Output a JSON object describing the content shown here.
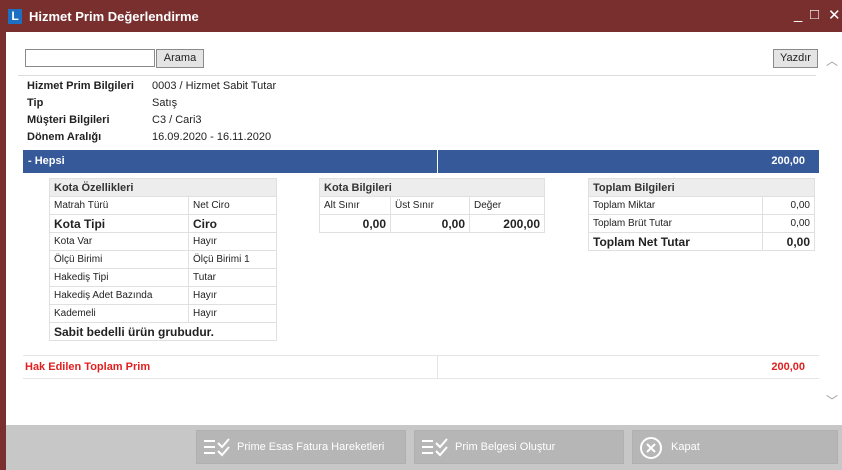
{
  "window": {
    "title": "Hizmet Prim Değerlendirme",
    "icon_letter": "L"
  },
  "toolbar": {
    "search_value": "",
    "search_button": "Arama",
    "print_button": "Yazdır"
  },
  "info": [
    {
      "label": "Hizmet Prim Bilgileri",
      "value": "0003 / Hizmet Sabit Tutar"
    },
    {
      "label": "Tip",
      "value": "Satış"
    },
    {
      "label": "Müşteri Bilgileri",
      "value": "C3 / Cari3"
    },
    {
      "label": "Dönem Aralığı",
      "value": "16.09.2020 - 16.11.2020"
    }
  ],
  "group": {
    "label": "- Hepsi",
    "total": "200,00"
  },
  "kota_ozellikleri": {
    "header": "Kota Özellikleri",
    "rows": [
      {
        "label": "Matrah Türü",
        "value": "Net Ciro"
      },
      {
        "label": "Kota Tipi",
        "value": "Ciro"
      },
      {
        "label": "Kota Var",
        "value": "Hayır"
      },
      {
        "label": "Ölçü Birimi",
        "value": "Ölçü Birimi 1"
      },
      {
        "label": "Hakediş Tipi",
        "value": "Tutar"
      },
      {
        "label": "Hakediş Adet Bazında",
        "value": "Hayır"
      },
      {
        "label": "Kademeli",
        "value": "Hayır"
      }
    ],
    "note": "Sabit bedelli ürün grubudur."
  },
  "kota_bilgileri": {
    "header": "Kota Bilgileri",
    "columns": [
      "Alt Sınır",
      "Üst Sınır",
      "Değer"
    ],
    "values": [
      "0,00",
      "0,00",
      "200,00"
    ]
  },
  "toplam_bilgileri": {
    "header": "Toplam Bilgileri",
    "rows": [
      {
        "label": "Toplam Miktar",
        "value": "0,00"
      },
      {
        "label": "Toplam Brüt Tutar",
        "value": "0,00"
      },
      {
        "label": "Toplam Net Tutar",
        "value": "0,00"
      }
    ]
  },
  "hak_edilen": {
    "label": "Hak Edilen Toplam Prim",
    "value": "200,00"
  },
  "footer": {
    "btn_fatura": "Prime Esas Fatura Hareketleri",
    "btn_belge": "Prim Belgesi Oluştur",
    "btn_kapat": "Kapat"
  },
  "colors": {
    "titlebar": "#7a2f2f",
    "group_bar": "#36599a",
    "highlight_red": "#e02020",
    "footer_bg": "#c7c7c7"
  },
  "icons": [
    "app-icon",
    "minimize-icon",
    "maximize-icon",
    "close-icon",
    "chevron-up-icon",
    "chevron-down-icon",
    "list-check-icon",
    "close-circle-icon"
  ]
}
